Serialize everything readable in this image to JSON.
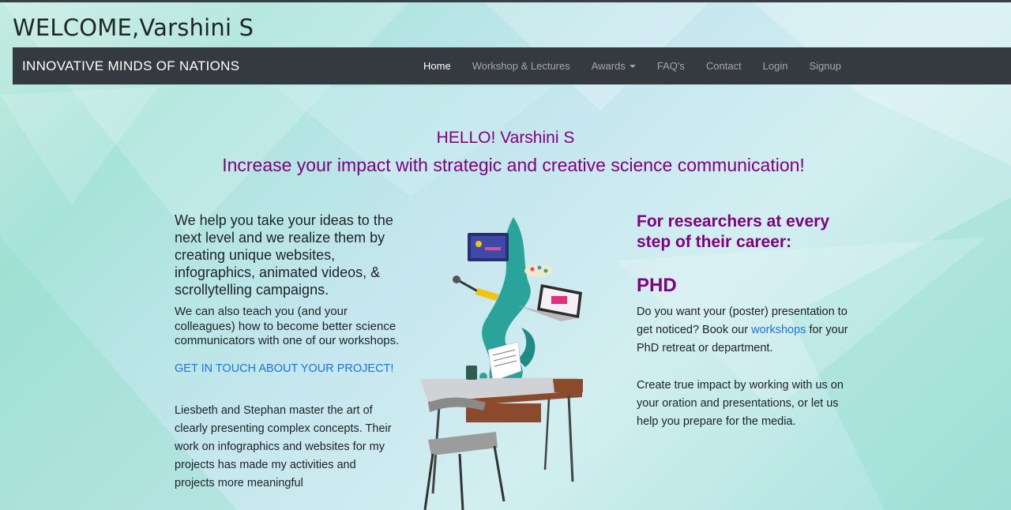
{
  "header": {
    "welcome": "WELCOME,Varshini S"
  },
  "navbar": {
    "brand": "INNOVATIVE MINDS OF NATIONS",
    "links": [
      {
        "label": "Home",
        "active": true
      },
      {
        "label": "Workshop & Lectures"
      },
      {
        "label": "Awards",
        "dropdown": true
      },
      {
        "label": "FAQ's"
      },
      {
        "label": "Contact"
      },
      {
        "label": "Login"
      },
      {
        "label": "Signup"
      }
    ]
  },
  "hero": {
    "hello": "HELLO! Varshini S",
    "tagline": "Increase your impact with strategic and creative science communication!"
  },
  "left": {
    "lead": "We help you take your ideas to the next level and we realize them by creating unique websites, infographics, animated videos, & scrollytelling campaigns.",
    "sub": "We can also teach you (and your colleagues) how to become better science communicators with one of our workshops.",
    "cta": "GET IN TOUCH ABOUT YOUR PROJECT!",
    "testimonial": "Liesbeth and Stephan master the art of clearly presenting complex concepts. Their work on infographics and websites for my projects has made my activities and projects more meaningful"
  },
  "right": {
    "heading": "For researchers at every step of their career:",
    "phd_heading": "PHD",
    "phd_text_before": "Do you want your (poster) presentation to get noticed? Book our",
    "phd_link": "workshops",
    "phd_text_after": "for your PhD retreat or department.",
    "impact_text": "Create true impact by working with us on your oration and presentations, or let us help you prepare for the media."
  },
  "colors": {
    "accent": "#800080",
    "link": "#1a73e8",
    "navbar": "#343a40"
  }
}
